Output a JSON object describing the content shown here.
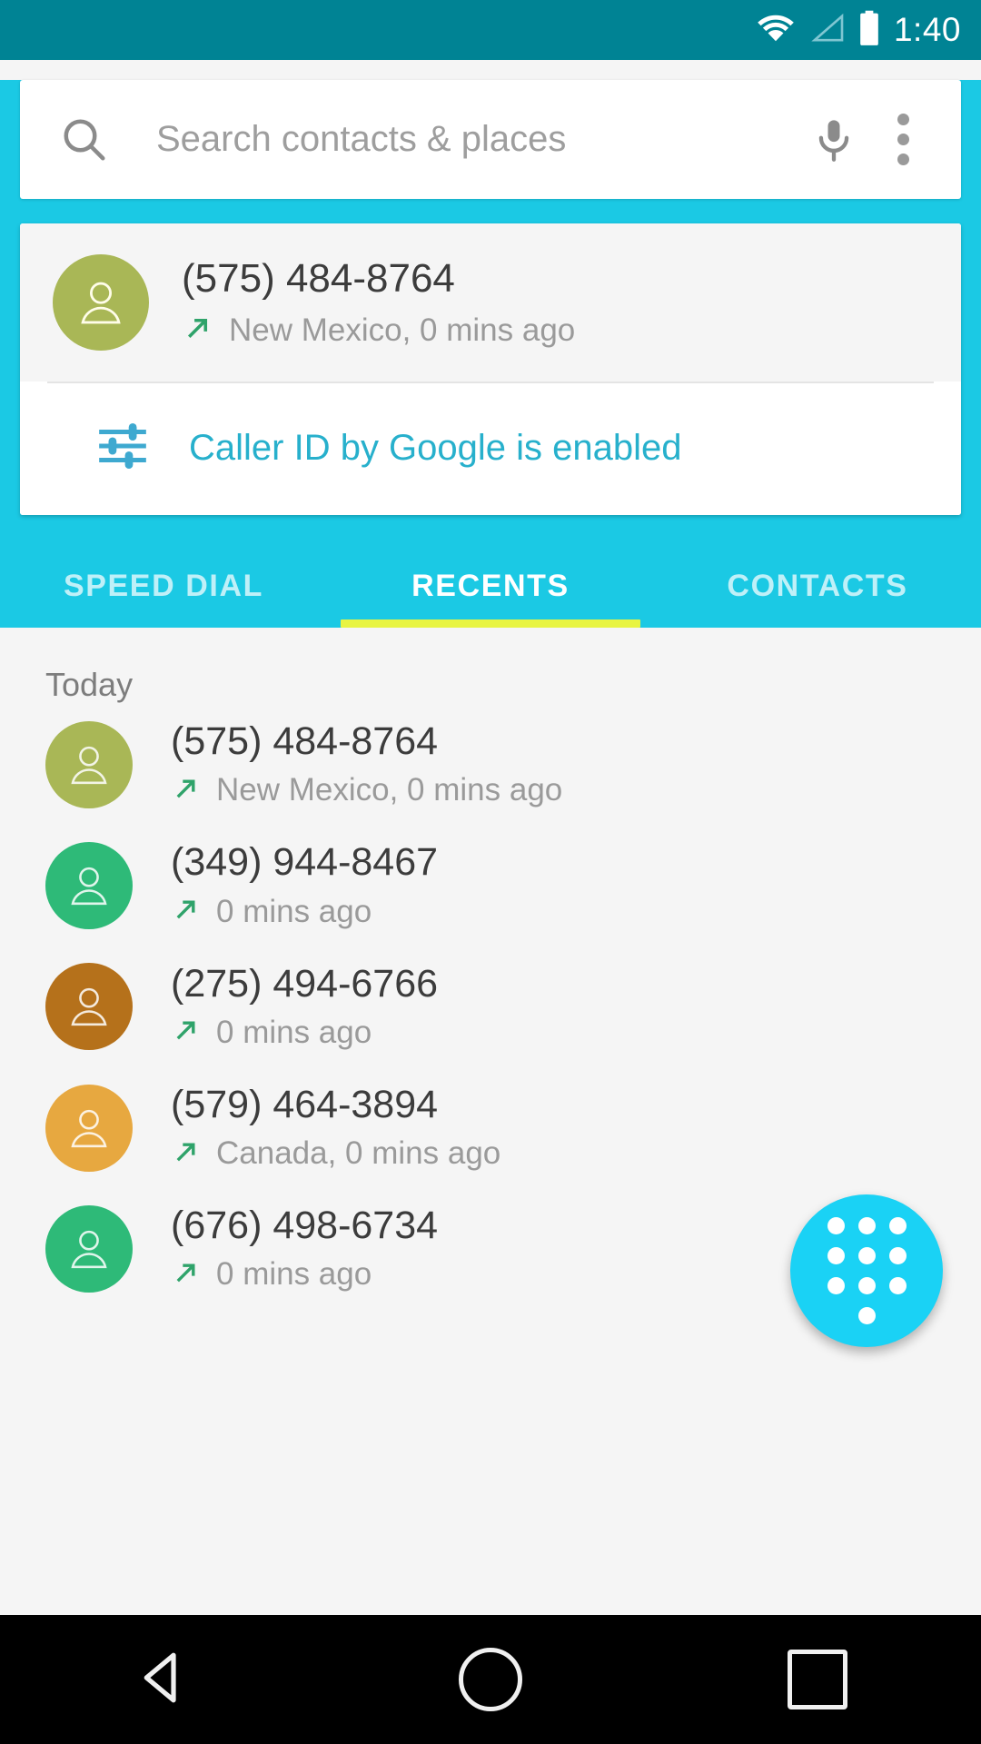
{
  "status_bar": {
    "time": "1:40",
    "icons": [
      "wifi-icon",
      "signal-icon",
      "battery-icon"
    ],
    "background": "#008394"
  },
  "search": {
    "placeholder": "Search contacts & places",
    "search_icon": "search-icon",
    "mic_icon": "microphone-icon",
    "overflow_icon": "overflow-menu-icon"
  },
  "call_card": {
    "number": "(575) 484-8764",
    "subtitle": "New Mexico, 0 mins ago",
    "call_direction": "outgoing-call-icon",
    "avatar_color": "#a9b756",
    "caller_id": {
      "label": "Caller ID by Google is enabled",
      "icon": "settings-sliders-icon",
      "color": "#27b0cc"
    }
  },
  "tabs": {
    "items": [
      {
        "label": "SPEED DIAL",
        "active": false
      },
      {
        "label": "RECENTS",
        "active": true
      },
      {
        "label": "CONTACTS",
        "active": false
      }
    ],
    "indicator_color": "#e8f442"
  },
  "recents": {
    "section_header": "Today",
    "calls": [
      {
        "number": "(575) 484-8764",
        "subtitle": "New Mexico, 0 mins ago",
        "avatar_color": "#a9b756",
        "direction": "outgoing"
      },
      {
        "number": "(349) 944-8467",
        "subtitle": "0 mins ago",
        "avatar_color": "#2eba78",
        "direction": "outgoing"
      },
      {
        "number": "(275) 494-6766",
        "subtitle": "0 mins ago",
        "avatar_color": "#b5711b",
        "direction": "outgoing"
      },
      {
        "number": "(579) 464-3894",
        "subtitle": "Canada, 0 mins ago",
        "avatar_color": "#e7a840",
        "direction": "outgoing"
      },
      {
        "number": "(676) 498-6734",
        "subtitle": "0 mins ago",
        "avatar_color": "#2eba78",
        "direction": "outgoing"
      }
    ]
  },
  "fab": {
    "icon": "dialpad-icon",
    "color": "#1ad2f5"
  },
  "nav_bar": {
    "back": "back-icon",
    "home": "home-icon",
    "recents": "recents-icon"
  },
  "theme": {
    "app_bar": "#1BC9E4",
    "status_bar": "#008394",
    "accent": "#1ad2f5",
    "outgoing_arrow": "#2fa36a"
  }
}
